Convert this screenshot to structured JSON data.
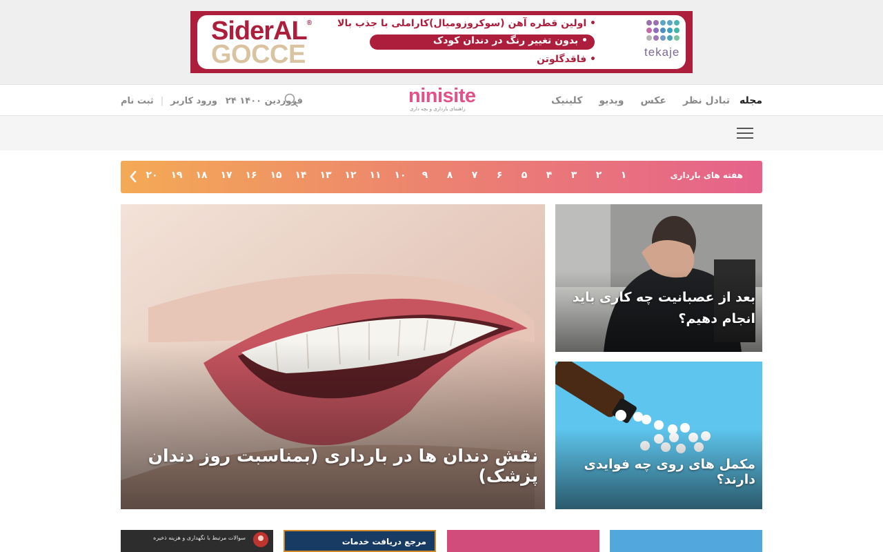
{
  "ad": {
    "brand_line1": "SiderAL",
    "brand_registered": "®",
    "brand_line2": "GOCCE",
    "lines": [
      "اولین قطره آهن (سوکروزومیال)کاراملی با جذب بالا",
      "بدون تغییر رنگ در دندان کودک",
      "فاقدگلوتن"
    ],
    "bullet": "•",
    "sponsor": "tekaje",
    "brand_color": "#ad1e3c",
    "icon": "tekaje-logo-dots"
  },
  "header": {
    "nav": [
      {
        "label": "مجله",
        "active": true
      },
      {
        "label": "تبادل نظر",
        "active": false
      },
      {
        "label": "عکس",
        "active": false
      },
      {
        "label": "ویدیو",
        "active": false
      },
      {
        "label": "کلینیک",
        "active": false
      }
    ],
    "logo": {
      "main": "ninisite",
      "sub": "راهنمای بارداری و بچه داری"
    },
    "date": "۲۴ فروردین ۱۴۰۰",
    "login": "ورود کاربر",
    "separator": "|",
    "register": "ثبت نام",
    "search_icon": "search-icon"
  },
  "subbar": {
    "menu_icon": "hamburger-menu-icon"
  },
  "weeks": {
    "title": "هفته های بارداری",
    "numbers": [
      "۱",
      "۲",
      "۳",
      "۴",
      "۵",
      "۶",
      "۷",
      "۸",
      "۹",
      "۱۰",
      "۱۱",
      "۱۲",
      "۱۳",
      "۱۴",
      "۱۵",
      "۱۶",
      "۱۷",
      "۱۸",
      "۱۹",
      "۲۰"
    ],
    "arrow_icon": "chevron-left-icon",
    "gradient": [
      "#f4aa55",
      "#e5628b"
    ]
  },
  "articles": {
    "hero": {
      "title": "نقش دندان ها در بارداری (بمناسبت روز دندان پزشک)"
    },
    "side": [
      {
        "title": "بعد از عصبانیت چه کاری باید انجام دهیم؟"
      },
      {
        "title": "مکمل های روی چه فوایدی دارند؟"
      }
    ]
  },
  "bottom": {
    "card1_text": "سوالات مرتبط با نگهداری و هزینه ذخیره",
    "card2_text": "مرجع دریافت خدمات"
  }
}
